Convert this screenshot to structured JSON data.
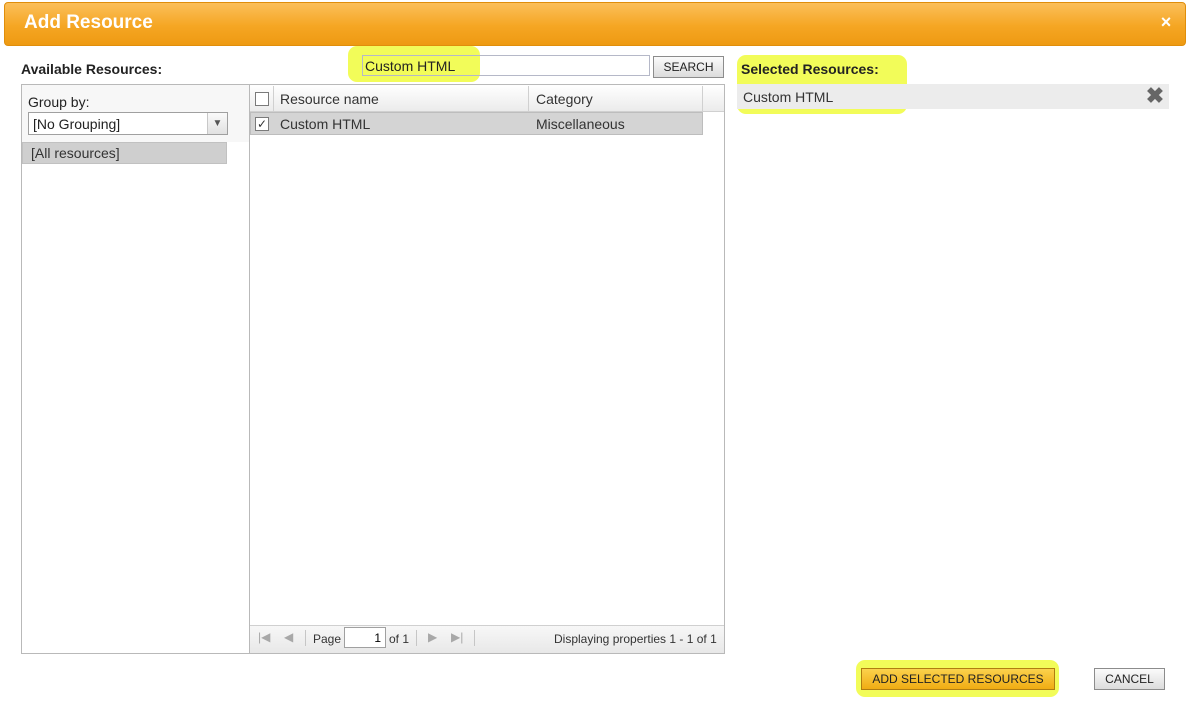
{
  "dialog": {
    "title": "Add Resource",
    "close_symbol": "×"
  },
  "available": {
    "label": "Available Resources:",
    "search": {
      "value": "Custom HTML",
      "button_label": "SEARCH"
    },
    "group_by": {
      "label": "Group by:",
      "selected": "[No Grouping]",
      "arrow": "▼"
    },
    "groups": [
      "[All resources]"
    ],
    "grid": {
      "columns": [
        "Resource name",
        "Category"
      ],
      "rows": [
        {
          "checked": true,
          "check_mark": "✓",
          "name": "Custom HTML",
          "category": "Miscellaneous"
        }
      ]
    },
    "pager": {
      "first_icon": "|◀",
      "prev_icon": "◀",
      "next_icon": "▶",
      "last_icon": "▶|",
      "page_label": "Page",
      "page_value": "1",
      "of_label": "of 1",
      "display_text": "Displaying properties 1 - 1 of 1"
    }
  },
  "selected": {
    "label": "Selected Resources:",
    "items": [
      {
        "name": "Custom HTML",
        "remove_symbol": "✖"
      }
    ]
  },
  "footer": {
    "add_label": "ADD SELECTED RESOURCES",
    "cancel_label": "CANCEL"
  },
  "colors": {
    "titlebar": "#f5a623",
    "highlight": "#f0fc3c"
  }
}
